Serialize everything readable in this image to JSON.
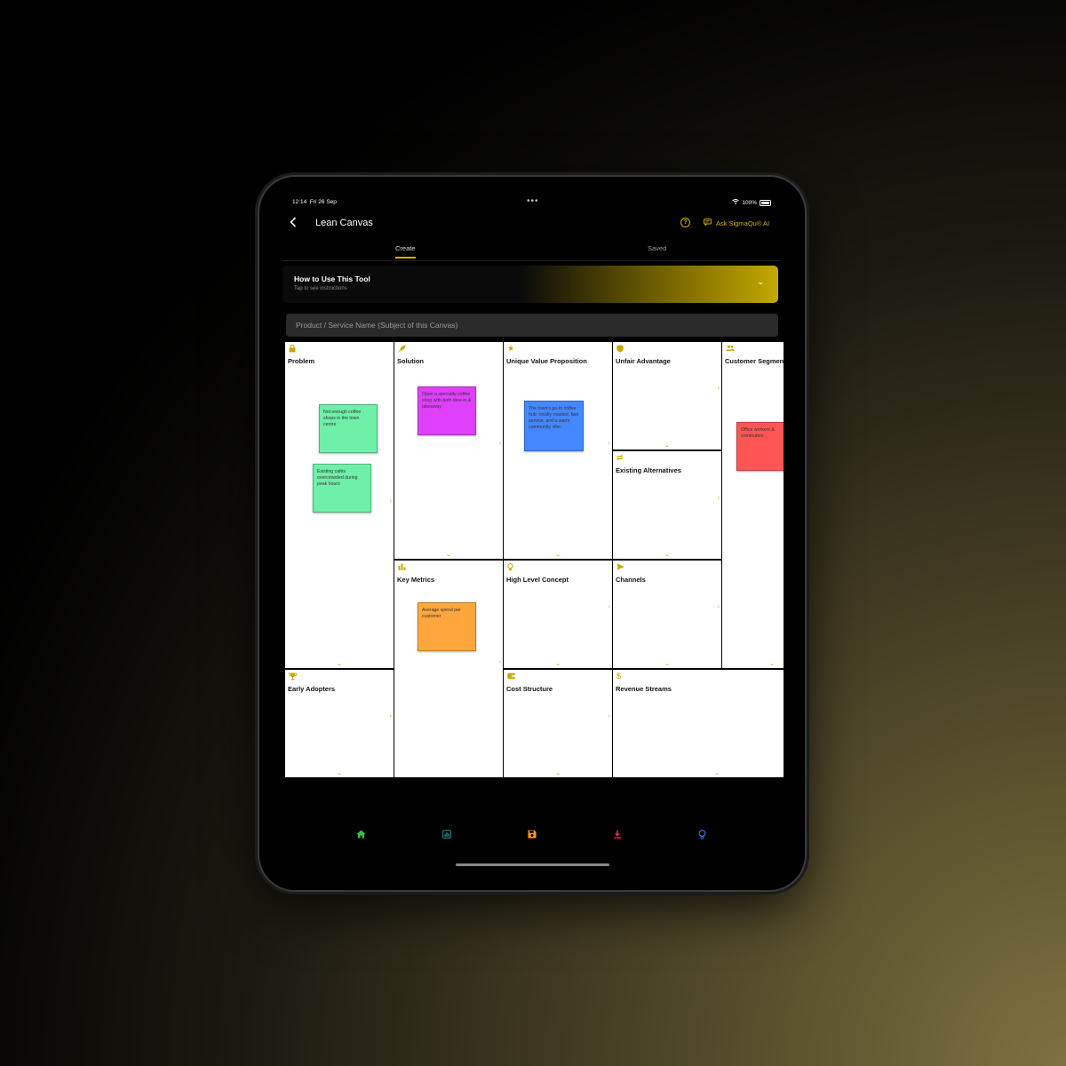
{
  "status_bar": {
    "time": "12:14",
    "date": "Fri 26 Sep",
    "dots": "•••",
    "wifi_icon": "wifi-icon",
    "battery": "100%"
  },
  "header": {
    "back_icon": "chevron-left-icon",
    "title": "Lean Canvas",
    "help_icon": "?",
    "ask_ai_label": "Ask SigmaQu® AI"
  },
  "tabs": {
    "create": "Create",
    "saved": "Saved"
  },
  "how_to": {
    "title": "How to Use This Tool",
    "subtitle": "Tap to see instructions"
  },
  "product_field": {
    "placeholder": "Product / Service Name (Subject of this Canvas)",
    "value": ""
  },
  "canvas": {
    "problem": {
      "label": "Problem",
      "icon": "lock-icon",
      "notes": [
        "Not enough coffee shops in the town centre",
        "Existing cafés overcrowded during peak hours"
      ]
    },
    "solution": {
      "label": "Solution",
      "icon": "rocket-icon",
      "notes": [
        "Open a specialty coffee shop with both dine-in & takeaway"
      ]
    },
    "uvp": {
      "label": "Unique Value Proposition",
      "icon": "star-icon",
      "notes": [
        "The town's go-to coffee hub: locally roasted, fast service, and a warm community vibe."
      ]
    },
    "unfair_advantage": {
      "label": "Unfair Advantage",
      "icon": "shield-icon"
    },
    "customer_segments": {
      "label": "Customer Segments",
      "icon": "people-icon",
      "notes": [
        "Office workers & commuters"
      ]
    },
    "existing_alternatives": {
      "label": "Existing Alternatives",
      "icon": "swap-icon"
    },
    "key_metrics": {
      "label": "Key Metrics",
      "icon": "bar-chart-icon",
      "notes": [
        "Average spend per customer"
      ]
    },
    "high_level_concept": {
      "label": "High Level Concept",
      "icon": "lightbulb-icon"
    },
    "channels": {
      "label": "Channels",
      "icon": "send-icon"
    },
    "early_adopters": {
      "label": "Early Adopters",
      "icon": "trophy-icon"
    },
    "cost_structure": {
      "label": "Cost Structure",
      "icon": "wallet-icon"
    },
    "revenue_streams": {
      "label": "Revenue Streams",
      "icon": "dollar-icon"
    }
  },
  "bottom_nav": [
    "home-icon",
    "chart-icon",
    "save-icon",
    "download-icon",
    "lightbulb-icon"
  ],
  "colors": {
    "accent": "#d4b100",
    "note_green": "#6ef0a8",
    "note_magenta": "#e040fb",
    "note_blue": "#4488ff",
    "note_red": "#ff5555",
    "note_orange": "#ffa73c"
  }
}
